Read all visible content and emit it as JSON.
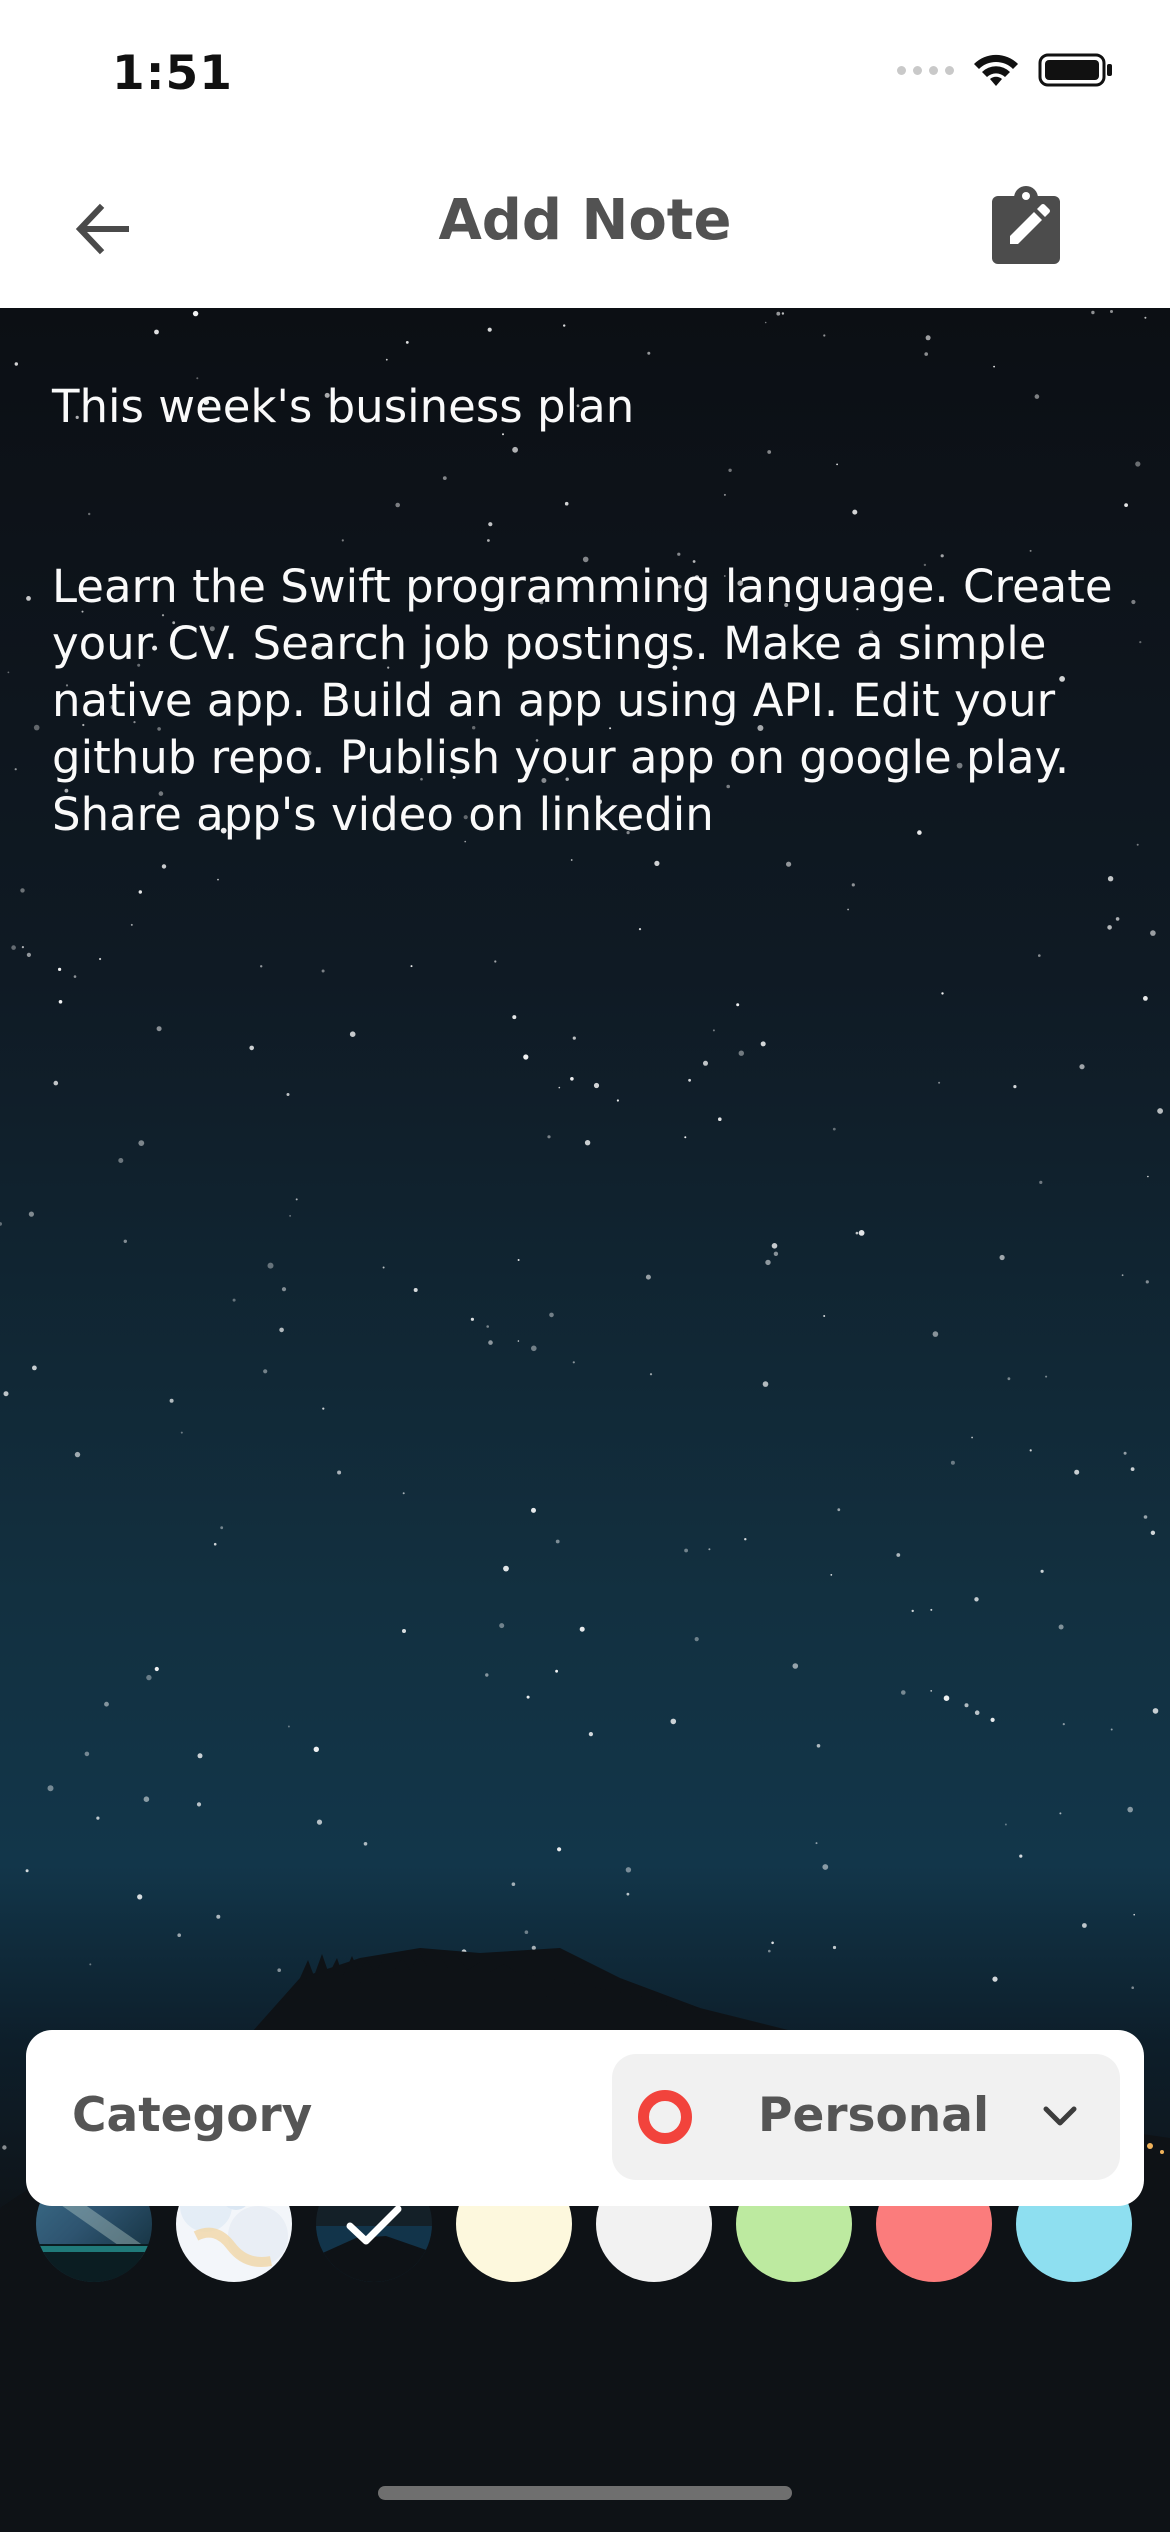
{
  "status_bar": {
    "time": "1:51"
  },
  "header": {
    "title": "Add Note"
  },
  "note": {
    "title": "This week's business plan",
    "body": "Learn the Swift programming language. Create your CV. Search job postings. Make a simple native app. Build an app using API. Edit your github repo. Publish your app on google play. Share app's video on linkedin"
  },
  "colors": {
    "swatches": [
      "image-galaxy",
      "image-clouds",
      "image-night-sky",
      "#fdf8dd",
      "#f2f2f2",
      "#bdeaa0",
      "#fb7c7c",
      "#8edff0"
    ],
    "selected_index": 2,
    "accent_red": "#f2433c"
  },
  "category": {
    "label": "Category",
    "value": "Personal",
    "icon": "ring-dot-icon"
  }
}
